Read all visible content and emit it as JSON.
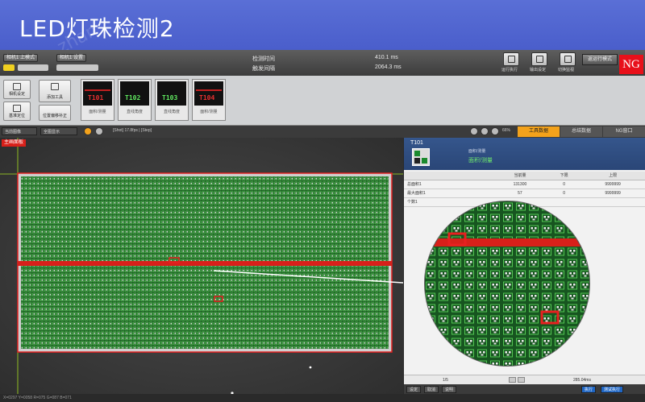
{
  "banner": {
    "title": "LED灯珠检测2"
  },
  "header": {
    "btn1": "相机1 上模式",
    "btn2": "相机1 设置",
    "time_label": "检测时间",
    "time_value": "410.1 ms",
    "interval_label": "触发间隔",
    "interval_value": "2064.3 ms",
    "tools": [
      "运行执行",
      "输出设定",
      "切换监视"
    ],
    "mode_button": "返运行模式",
    "ng": "NG"
  },
  "toolbar": {
    "buttons": [
      "相机设定",
      "添加工具",
      "基准定位",
      "位置偏移补正"
    ],
    "tiles": [
      {
        "tag": "T101",
        "cap": "面积/测量",
        "ok": false
      },
      {
        "tag": "T102",
        "cap": "直线角度",
        "ok": true
      },
      {
        "tag": "T103",
        "cap": "直线角度",
        "ok": true
      },
      {
        "tag": "T104",
        "cap": "面积/测量",
        "ok": false
      }
    ]
  },
  "subbar": {
    "sel1": "当前图像",
    "sel2": "全图显示",
    "info": "[Shot] 17.8fps | [Step]",
    "zoom": "66%",
    "tabs": [
      "工具数据",
      "总结数据",
      "NG窗口"
    ]
  },
  "image": {
    "label": "主画面板"
  },
  "panel": {
    "tool_id": "T101",
    "category": "面积/测量",
    "name": "面积/测量",
    "table": {
      "headers": [
        "",
        "当前量",
        "下限",
        "上限"
      ],
      "rows": [
        [
          "总面积1",
          "131300",
          "0",
          "9999999"
        ],
        [
          "最大面积1",
          "57",
          "0",
          "9999999"
        ],
        [
          "个数1",
          "",
          "",
          ""
        ]
      ]
    },
    "footer_page": "1/5",
    "footer_time": "285.04ms",
    "bottom": [
      "设定",
      "取消",
      "说明",
      "执行",
      "测试执行"
    ]
  },
  "status": {
    "text": "X=0297  Y=0058  R=075  G=087  B=071"
  },
  "colors": {
    "banner": "#4a5ecb",
    "ng": "#e8101a",
    "accent": "#f3a21b",
    "pcb_green": "#1e8a2a",
    "defect_red": "#d8201a"
  }
}
